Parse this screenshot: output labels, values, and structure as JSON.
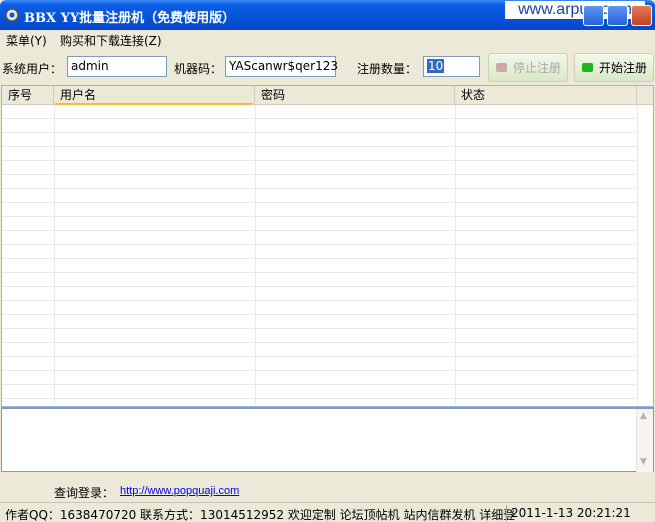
{
  "window": {
    "title": "BBX YY批量注册机（免费使用版）",
    "watermark": "www.arpun.com"
  },
  "menu": {
    "items": [
      {
        "label": "菜单(Y)"
      },
      {
        "label": "购买和下载连接(Z)"
      }
    ]
  },
  "toolbar": {
    "system_user_label": "系统用户：",
    "system_user_value": "admin",
    "machine_code_label": "机器码：",
    "machine_code_value": "YAScanwr$qer123",
    "register_count_label": "注册数量：",
    "register_count_value": "10",
    "stop_button": "停止注册",
    "start_button": "开始注册",
    "stop_led_color": "#c9a9a6",
    "start_led_color": "#1fb51f"
  },
  "grid": {
    "columns": [
      {
        "label": "序号"
      },
      {
        "label": "用户名"
      },
      {
        "label": "密码"
      },
      {
        "label": "状态"
      }
    ]
  },
  "query": {
    "label": "查询登录：",
    "link": "http://www.popquaji.com"
  },
  "status": {
    "left": "作者QQ：1638470720 联系方式：13014512952 欢迎定制 论坛顶帖机 站内信群发机 详细登",
    "right": "2011-1-13 20:21:21"
  }
}
